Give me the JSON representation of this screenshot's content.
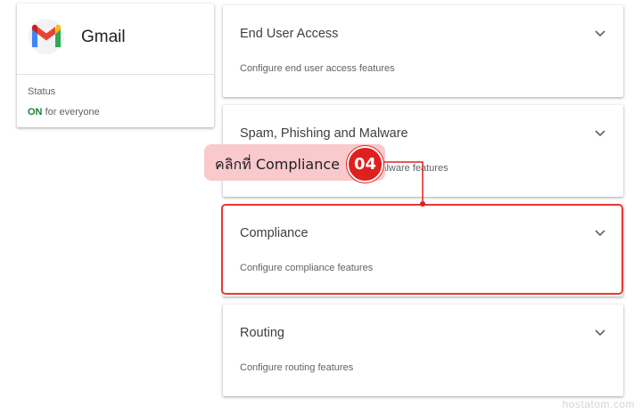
{
  "app": {
    "name": "Gmail",
    "status_label": "Status",
    "status_value": "ON",
    "status_scope": "for everyone",
    "logo_icon": "gmail-logo-icon"
  },
  "settings": [
    {
      "title": "End User Access",
      "description": "Configure end user access features",
      "icon": "chevron-down-icon"
    },
    {
      "title": "Spam, Phishing and Malware",
      "description": "Configure spam, phishing and malware features",
      "icon": "chevron-down-icon"
    },
    {
      "title": "Compliance",
      "description": "Configure compliance features",
      "icon": "chevron-down-icon"
    },
    {
      "title": "Routing",
      "description": "Configure routing features",
      "icon": "chevron-down-icon"
    }
  ],
  "annotation": {
    "instruction": "คลิกที่ Compliance",
    "step": "04",
    "highlight_color": "#e53935",
    "callout_color": "#f9c9cc"
  },
  "watermark": "hostatom.com",
  "colors": {
    "status_on": "#188038",
    "accent_red": "#e0201e"
  }
}
